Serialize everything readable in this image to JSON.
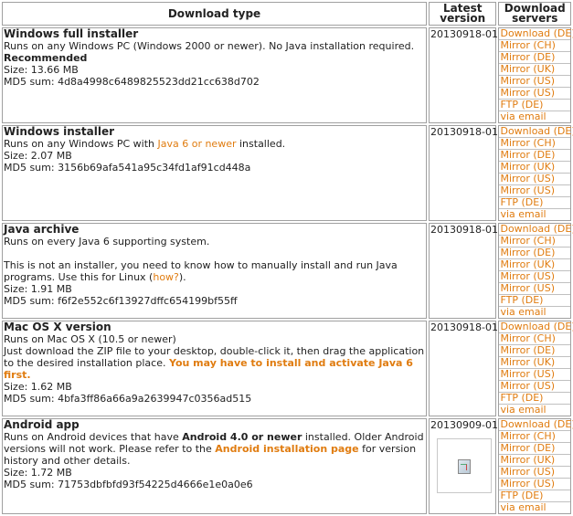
{
  "headers": {
    "type": "Download type",
    "version": "Latest version",
    "servers": "Download servers"
  },
  "servers": [
    "Download (DE)",
    "Mirror (CH)",
    "Mirror (DE)",
    "Mirror (UK)",
    "Mirror (US)",
    "Mirror (US)",
    "FTP (DE)",
    "via email"
  ],
  "rows": [
    {
      "title": "Windows full installer",
      "desc1": "Runs on any Windows PC (Windows 2000 or newer). No Java installation required. ",
      "recommended": "Recommended",
      "size": "Size: 13.66 MB",
      "md5": "MD5 sum: 4d8a4998c6489825523dd21cc638d702",
      "version": "20130918-01"
    },
    {
      "title": "Windows installer",
      "desc_pre": "Runs on any Windows PC with ",
      "desc_link": "Java 6 or newer",
      "desc_post": " installed.",
      "size": "Size: 2.07 MB",
      "md5": "MD5 sum: 3156b69afa541a95c34fd1af91cd448a",
      "version": "20130918-01"
    },
    {
      "title": "Java archive",
      "desc1": "Runs on every Java 6 supporting system.",
      "desc2_pre": "This is not an installer, you need to know how to manually install and run Java programs. Use this for Linux (",
      "desc2_link": "how?",
      "desc2_post": ").",
      "size": "Size: 1.91 MB",
      "md5": "MD5 sum: f6f2e552c6f13927dffc654199bf55ff",
      "version": "20130918-01"
    },
    {
      "title": "Mac OS X version",
      "desc1": "Runs on Mac OS X (10.5 or newer)",
      "desc2": "Just download the ZIP file to your desktop, double-click it, then drag the application to the desired installation place. ",
      "desc2_link": "You may have to install and activate Java 6 first.",
      "size": "Size: 1.62 MB",
      "md5": "MD5 sum: 4bfa3ff86a66a9a2639947c0356ad515",
      "version": "20130918-01"
    },
    {
      "title": "Android app",
      "desc_pre": "Runs on Android devices that have ",
      "desc_bold": "Android 4.0 or newer",
      "desc_mid": " installed. Older Android versions will not work. Please refer to the ",
      "desc_link": "Android installation page",
      "desc_post": " for version history and other details.",
      "size": "Size: 1.72 MB",
      "md5": "MD5 sum: 71753dbfbfd93f54225d4666e1e0a0e6",
      "version": "20130909-01"
    }
  ]
}
